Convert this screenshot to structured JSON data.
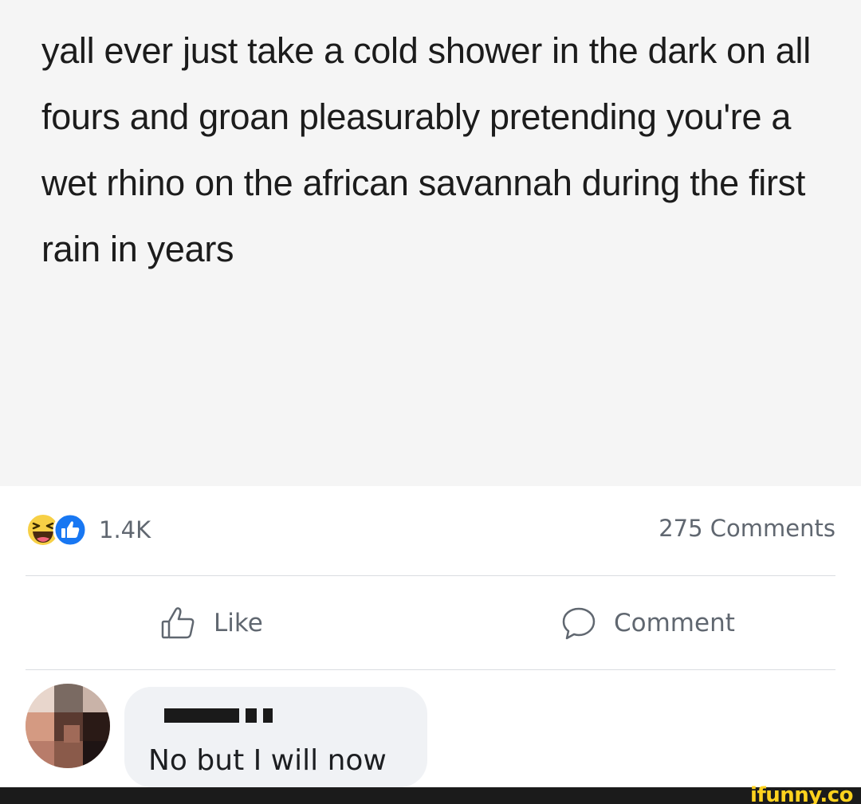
{
  "post": {
    "text": "yall ever just take a cold shower in the dark on all fours and groan pleasurably pretending you're a wet rhino on the african savannah during the first rain in years"
  },
  "reactions": {
    "icons": [
      "haha-reaction-icon",
      "like-reaction-icon"
    ],
    "count": "1.4K"
  },
  "comments_summary": "275 Comments",
  "actions": {
    "like_label": "Like",
    "comment_label": "Comment"
  },
  "comment": {
    "author_redacted": true,
    "text": "No but I will now"
  },
  "watermark": "ifunny.co",
  "colors": {
    "secondary_text": "#606770",
    "like_blue": "#1877f2",
    "haha_yellow": "#f7d046",
    "bubble_bg": "#f0f2f5",
    "watermark_yellow": "#ffd21e"
  }
}
